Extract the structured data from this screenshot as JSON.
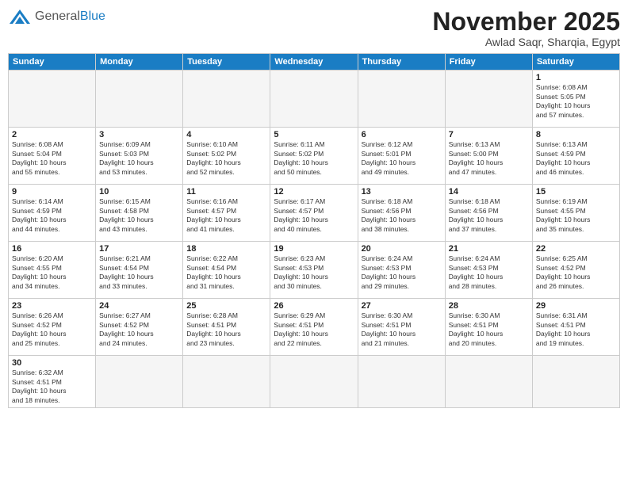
{
  "header": {
    "logo_general": "General",
    "logo_blue": "Blue",
    "month_title": "November 2025",
    "location": "Awlad Saqr, Sharqia, Egypt"
  },
  "days_of_week": [
    "Sunday",
    "Monday",
    "Tuesday",
    "Wednesday",
    "Thursday",
    "Friday",
    "Saturday"
  ],
  "weeks": [
    [
      {
        "day": null,
        "info": null
      },
      {
        "day": null,
        "info": null
      },
      {
        "day": null,
        "info": null
      },
      {
        "day": null,
        "info": null
      },
      {
        "day": null,
        "info": null
      },
      {
        "day": null,
        "info": null
      },
      {
        "day": "1",
        "info": "Sunrise: 6:08 AM\nSunset: 5:05 PM\nDaylight: 10 hours\nand 57 minutes."
      }
    ],
    [
      {
        "day": "2",
        "info": "Sunrise: 6:08 AM\nSunset: 5:04 PM\nDaylight: 10 hours\nand 55 minutes."
      },
      {
        "day": "3",
        "info": "Sunrise: 6:09 AM\nSunset: 5:03 PM\nDaylight: 10 hours\nand 53 minutes."
      },
      {
        "day": "4",
        "info": "Sunrise: 6:10 AM\nSunset: 5:02 PM\nDaylight: 10 hours\nand 52 minutes."
      },
      {
        "day": "5",
        "info": "Sunrise: 6:11 AM\nSunset: 5:02 PM\nDaylight: 10 hours\nand 50 minutes."
      },
      {
        "day": "6",
        "info": "Sunrise: 6:12 AM\nSunset: 5:01 PM\nDaylight: 10 hours\nand 49 minutes."
      },
      {
        "day": "7",
        "info": "Sunrise: 6:13 AM\nSunset: 5:00 PM\nDaylight: 10 hours\nand 47 minutes."
      },
      {
        "day": "8",
        "info": "Sunrise: 6:13 AM\nSunset: 4:59 PM\nDaylight: 10 hours\nand 46 minutes."
      }
    ],
    [
      {
        "day": "9",
        "info": "Sunrise: 6:14 AM\nSunset: 4:59 PM\nDaylight: 10 hours\nand 44 minutes."
      },
      {
        "day": "10",
        "info": "Sunrise: 6:15 AM\nSunset: 4:58 PM\nDaylight: 10 hours\nand 43 minutes."
      },
      {
        "day": "11",
        "info": "Sunrise: 6:16 AM\nSunset: 4:57 PM\nDaylight: 10 hours\nand 41 minutes."
      },
      {
        "day": "12",
        "info": "Sunrise: 6:17 AM\nSunset: 4:57 PM\nDaylight: 10 hours\nand 40 minutes."
      },
      {
        "day": "13",
        "info": "Sunrise: 6:18 AM\nSunset: 4:56 PM\nDaylight: 10 hours\nand 38 minutes."
      },
      {
        "day": "14",
        "info": "Sunrise: 6:18 AM\nSunset: 4:56 PM\nDaylight: 10 hours\nand 37 minutes."
      },
      {
        "day": "15",
        "info": "Sunrise: 6:19 AM\nSunset: 4:55 PM\nDaylight: 10 hours\nand 35 minutes."
      }
    ],
    [
      {
        "day": "16",
        "info": "Sunrise: 6:20 AM\nSunset: 4:55 PM\nDaylight: 10 hours\nand 34 minutes."
      },
      {
        "day": "17",
        "info": "Sunrise: 6:21 AM\nSunset: 4:54 PM\nDaylight: 10 hours\nand 33 minutes."
      },
      {
        "day": "18",
        "info": "Sunrise: 6:22 AM\nSunset: 4:54 PM\nDaylight: 10 hours\nand 31 minutes."
      },
      {
        "day": "19",
        "info": "Sunrise: 6:23 AM\nSunset: 4:53 PM\nDaylight: 10 hours\nand 30 minutes."
      },
      {
        "day": "20",
        "info": "Sunrise: 6:24 AM\nSunset: 4:53 PM\nDaylight: 10 hours\nand 29 minutes."
      },
      {
        "day": "21",
        "info": "Sunrise: 6:24 AM\nSunset: 4:53 PM\nDaylight: 10 hours\nand 28 minutes."
      },
      {
        "day": "22",
        "info": "Sunrise: 6:25 AM\nSunset: 4:52 PM\nDaylight: 10 hours\nand 26 minutes."
      }
    ],
    [
      {
        "day": "23",
        "info": "Sunrise: 6:26 AM\nSunset: 4:52 PM\nDaylight: 10 hours\nand 25 minutes."
      },
      {
        "day": "24",
        "info": "Sunrise: 6:27 AM\nSunset: 4:52 PM\nDaylight: 10 hours\nand 24 minutes."
      },
      {
        "day": "25",
        "info": "Sunrise: 6:28 AM\nSunset: 4:51 PM\nDaylight: 10 hours\nand 23 minutes."
      },
      {
        "day": "26",
        "info": "Sunrise: 6:29 AM\nSunset: 4:51 PM\nDaylight: 10 hours\nand 22 minutes."
      },
      {
        "day": "27",
        "info": "Sunrise: 6:30 AM\nSunset: 4:51 PM\nDaylight: 10 hours\nand 21 minutes."
      },
      {
        "day": "28",
        "info": "Sunrise: 6:30 AM\nSunset: 4:51 PM\nDaylight: 10 hours\nand 20 minutes."
      },
      {
        "day": "29",
        "info": "Sunrise: 6:31 AM\nSunset: 4:51 PM\nDaylight: 10 hours\nand 19 minutes."
      }
    ],
    [
      {
        "day": "30",
        "info": "Sunrise: 6:32 AM\nSunset: 4:51 PM\nDaylight: 10 hours\nand 18 minutes."
      },
      {
        "day": null,
        "info": null
      },
      {
        "day": null,
        "info": null
      },
      {
        "day": null,
        "info": null
      },
      {
        "day": null,
        "info": null
      },
      {
        "day": null,
        "info": null
      },
      {
        "day": null,
        "info": null
      }
    ]
  ]
}
